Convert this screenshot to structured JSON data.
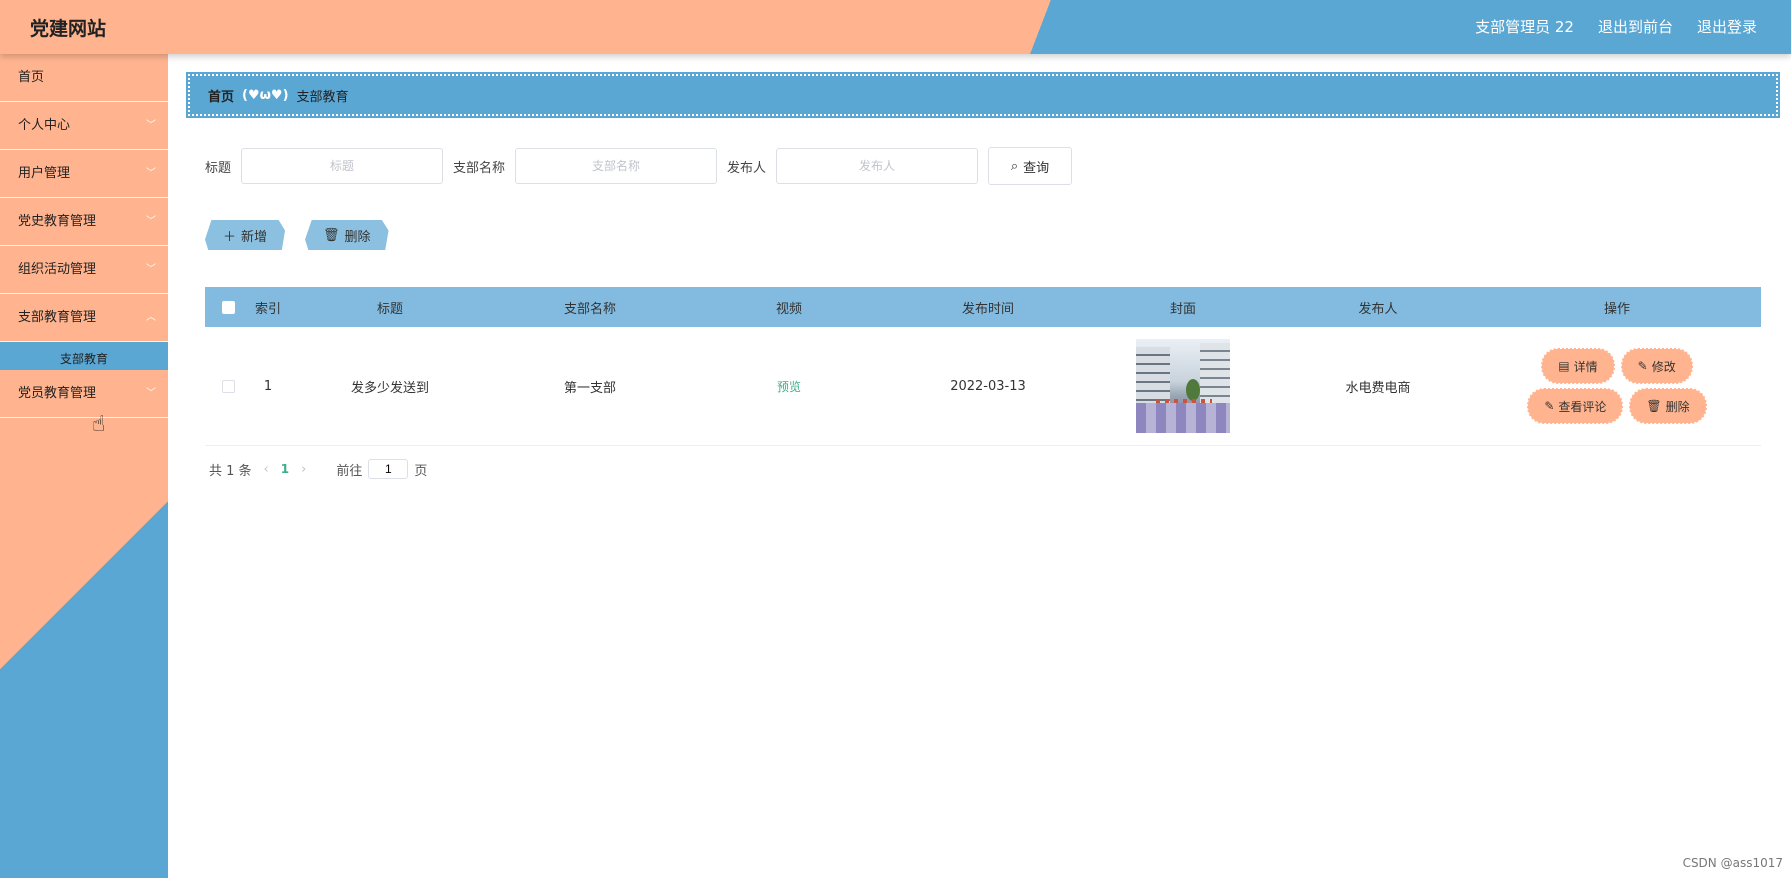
{
  "header": {
    "site_title": "党建网站",
    "user_label": "支部管理员 22",
    "to_frontend": "退出到前台",
    "logout": "退出登录"
  },
  "sidebar": {
    "items": [
      {
        "label": "首页",
        "has_children": false
      },
      {
        "label": "个人中心",
        "has_children": true
      },
      {
        "label": "用户管理",
        "has_children": true
      },
      {
        "label": "党史教育管理",
        "has_children": true
      },
      {
        "label": "组织活动管理",
        "has_children": true
      },
      {
        "label": "支部教育管理",
        "has_children": true,
        "expanded": true
      }
    ],
    "submenu_active": "支部教育",
    "last_item": "党员教育管理"
  },
  "breadcrumb": {
    "home": "首页",
    "separator": "(♥ω♥)",
    "current": "支部教育"
  },
  "search": {
    "title_label": "标题",
    "title_placeholder": "标题",
    "branch_label": "支部名称",
    "branch_placeholder": "支部名称",
    "publisher_label": "发布人",
    "publisher_placeholder": "发布人",
    "query_button": "查询"
  },
  "actions": {
    "add": "新增",
    "delete": "删除"
  },
  "table": {
    "columns": [
      "索引",
      "标题",
      "支部名称",
      "视频",
      "发布时间",
      "封面",
      "发布人",
      "操作"
    ],
    "rows": [
      {
        "index": "1",
        "title": "发多少发送到",
        "branch": "第一支部",
        "video": "预览",
        "time": "2022-03-13",
        "publisher": "水电费电商",
        "ops": {
          "detail": "详情",
          "edit": "修改",
          "comments": "查看评论",
          "delete": "删除"
        }
      }
    ]
  },
  "pagination": {
    "total_text": "共 1 条",
    "current_page": "1",
    "goto_label": "前往",
    "goto_value": "1",
    "page_unit": "页"
  },
  "watermark": "CSDN @ass1017",
  "colors": {
    "accent_peach": "#ffb48f",
    "accent_blue": "#5aa7d4",
    "table_header": "#82bbdf",
    "link_green": "#3dae8c"
  }
}
